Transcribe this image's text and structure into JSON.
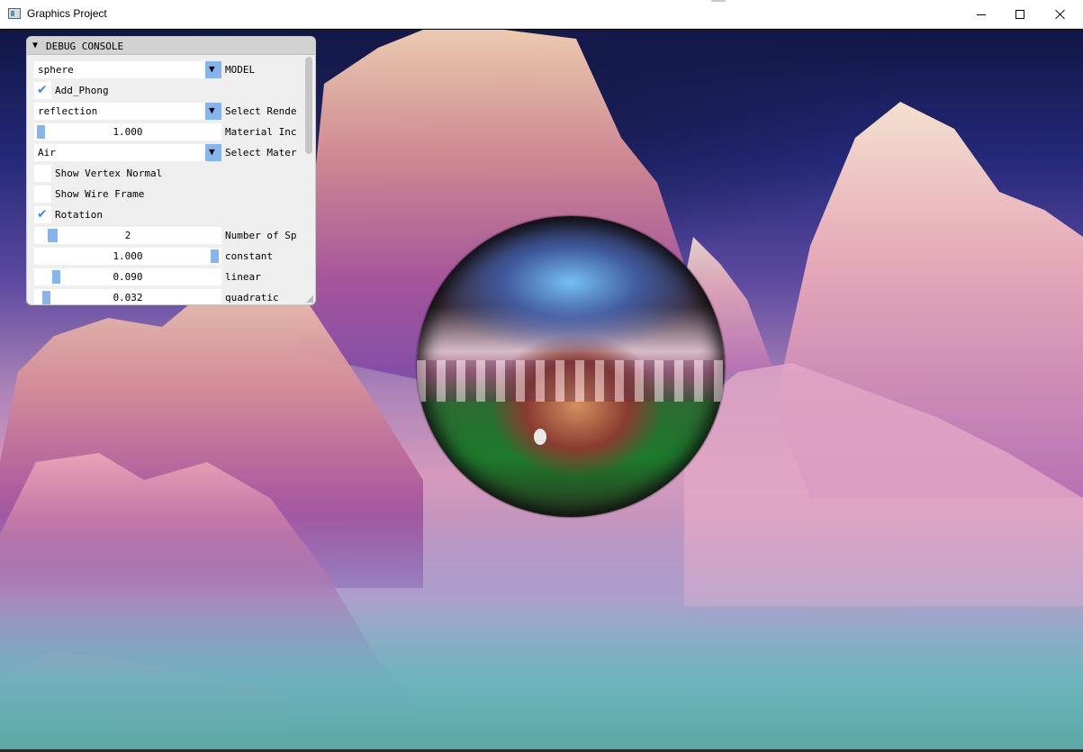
{
  "window": {
    "title": "Graphics Project"
  },
  "panel": {
    "title": "DEBUG CONSOLE",
    "model": {
      "value": "sphere",
      "label": "MODEL",
      "arrow": "▼"
    },
    "add_phong": {
      "label": "Add_Phong",
      "checked": true
    },
    "render_mode": {
      "value": "reflection",
      "label": "Select Rende",
      "arrow": "▼"
    },
    "material_index": {
      "value": "1.000",
      "label": "Material Inc",
      "fraction": 0.0
    },
    "material": {
      "value": "Air",
      "label": "Select Mater",
      "arrow": "▼"
    },
    "show_vertex_normal": {
      "label": "Show Vertex Normal",
      "checked": false
    },
    "show_wire_frame": {
      "label": "Show Wire Frame",
      "checked": false
    },
    "rotation": {
      "label": "Rotation",
      "checked": true
    },
    "num_spheres": {
      "value": "2",
      "label": "Number of Sp",
      "fraction": 0.1
    },
    "constant": {
      "value": "1.000",
      "label": "constant",
      "fraction": 1.0
    },
    "linear": {
      "value": "0.090",
      "label": "linear",
      "fraction": 0.09
    },
    "quadratic": {
      "value": "0.032",
      "label": "quadratic",
      "fraction": 0.032
    }
  },
  "icons": {
    "check": "✔",
    "collapse": "▼"
  },
  "colors": {
    "accent": "#85b5ef",
    "check": "#3a8ee8",
    "panel_bg": "#efefef"
  }
}
